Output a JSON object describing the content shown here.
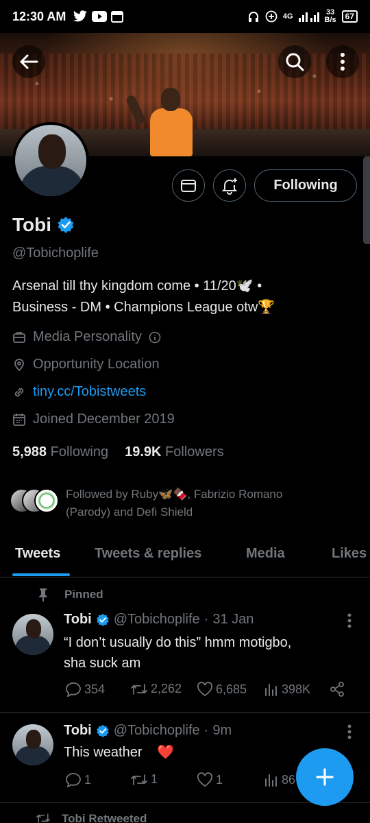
{
  "status_bar": {
    "time": "12:30 AM",
    "network": "4G",
    "speed_value": "33",
    "speed_unit": "B/s",
    "battery": "67"
  },
  "banner": {
    "icons": {
      "back": "arrow-left-icon",
      "search": "search-icon",
      "more": "more-vertical-icon"
    }
  },
  "profile": {
    "name": "Tobi",
    "handle": "@Tobichoplife",
    "bio_line1": "Arsenal till thy kingdom come • 11/20🕊️ •",
    "bio_line2": "Business - DM • Champions League otw🏆",
    "category": "Media Personality",
    "location": "Opportunity Location",
    "link": "tiny.cc/Tobistweets",
    "joined": "Joined December 2019",
    "following_count": "5,988",
    "following_label": "Following",
    "followers_count": "19.9K",
    "followers_label": "Followers",
    "followed_by_line1": "Followed by Ruby🦋🍫, Fabrizio Romano",
    "followed_by_line2": "(Parody) and Defi Shield",
    "follow_button": "Following",
    "verified_color": "#1d9bf0"
  },
  "tabs": [
    "Tweets",
    "Tweets & replies",
    "Media",
    "Likes"
  ],
  "pinned_label": "Pinned",
  "tweets": [
    {
      "name": "Tobi",
      "handle": "@Tobichoplife",
      "time": "31 Jan",
      "text_line1": "“I don’t usually do this” hmm motigbo,",
      "text_line2": "sha suck am",
      "replies": "354",
      "retweets": "2,262",
      "likes": "6,685",
      "views": "398K"
    },
    {
      "name": "Tobi",
      "handle": "@Tobichoplife",
      "time": "9m",
      "text_line1": "This weather",
      "emoji": "❤️",
      "replies": "1",
      "retweets": "1",
      "likes": "1",
      "views": "86"
    }
  ],
  "retweeted_label": "Tobi Retweeted",
  "colors": {
    "accent": "#1d9bf0",
    "muted": "#71767b",
    "text": "#e7e9ea",
    "background": "#000000",
    "heart": "#f91880"
  }
}
